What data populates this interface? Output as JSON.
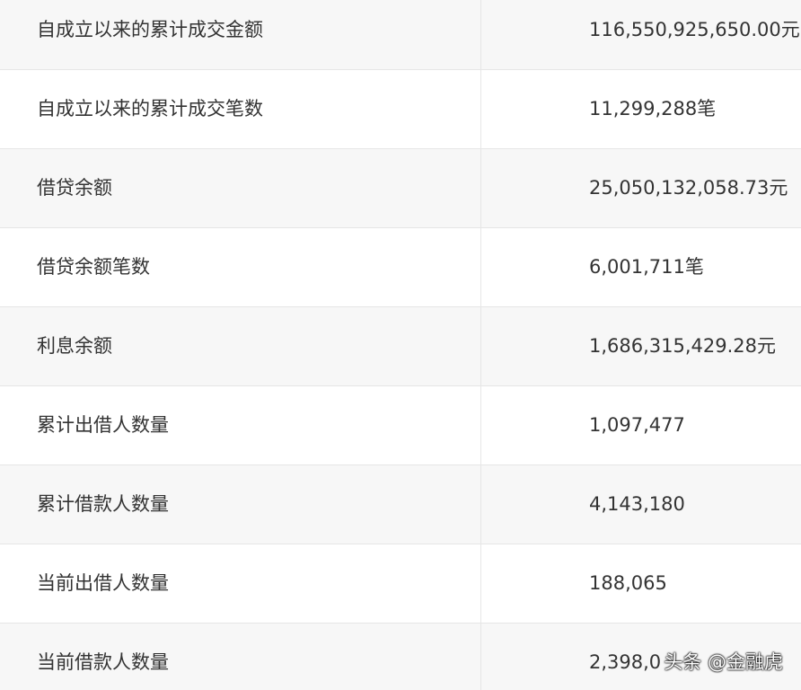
{
  "rows": [
    {
      "label": "自成立以来的累计成交金额",
      "value": "116,550,925,650.00元"
    },
    {
      "label": "自成立以来的累计成交笔数",
      "value": "11,299,288笔"
    },
    {
      "label": "借贷余额",
      "value": "25,050,132,058.73元"
    },
    {
      "label": "借贷余额笔数",
      "value": "6,001,711笔"
    },
    {
      "label": "利息余额",
      "value": "1,686,315,429.28元"
    },
    {
      "label": "累计出借人数量",
      "value": "1,097,477"
    },
    {
      "label": "累计借款人数量",
      "value": "4,143,180"
    },
    {
      "label": "当前出借人数量",
      "value": "188,065"
    },
    {
      "label": "当前借款人数量",
      "value": "2,398,0"
    }
  ],
  "watermark": "头条 @金融虎"
}
